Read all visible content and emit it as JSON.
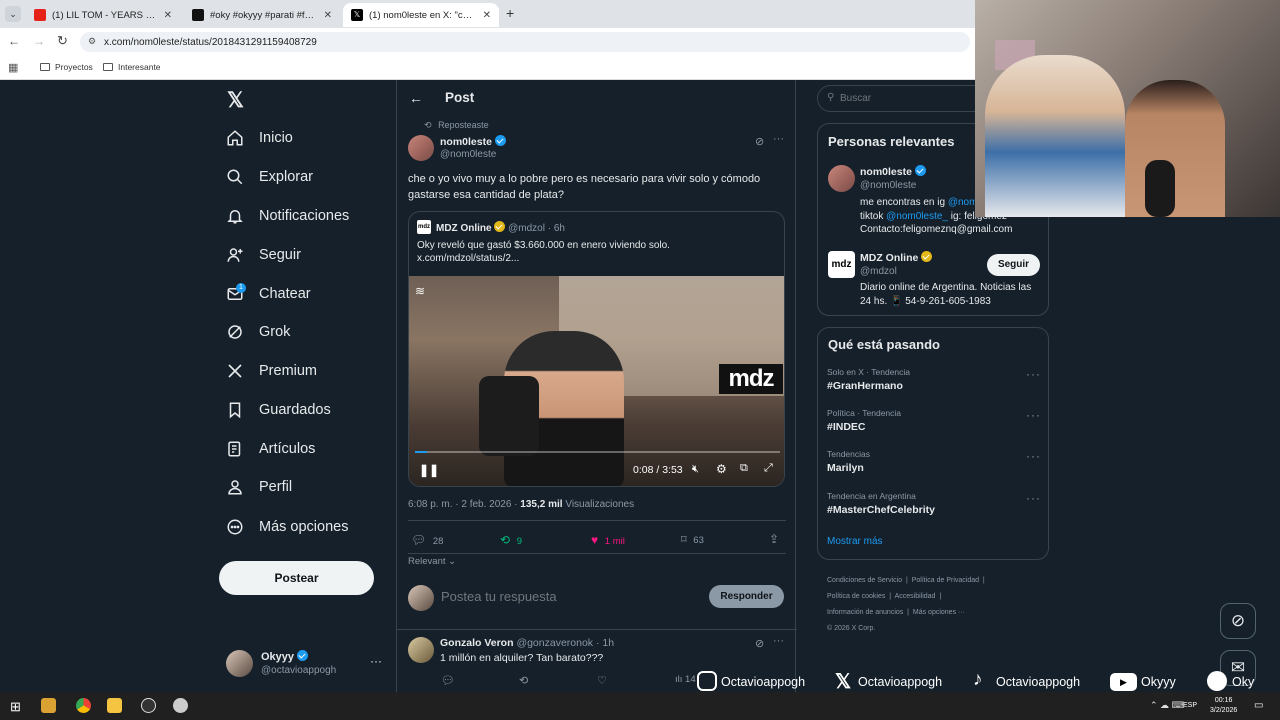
{
  "browser": {
    "tabs": [
      {
        "title": "(1) LIL TOM - YEARS + - YouTube"
      },
      {
        "title": "#oky #okyyy #parati #fyp #fory"
      },
      {
        "title": "(1) nom0leste en X: \"che o yo v"
      }
    ],
    "url": "x.com/nom0leste/status/2018431291159408729",
    "bookmarks": [
      "Proyectos",
      "Interesante"
    ]
  },
  "nav": {
    "items": [
      "Inicio",
      "Explorar",
      "Notificaciones",
      "Seguir",
      "Chatear",
      "Grok",
      "Premium",
      "Guardados",
      "Artículos",
      "Perfil",
      "Más opciones"
    ],
    "chat_badge": "1",
    "post_button": "Postear",
    "account": {
      "name": "Okyyy",
      "handle": "@octavioappogh"
    }
  },
  "post": {
    "header_title": "Post",
    "reposted_label": "Reposteaste",
    "author": {
      "name": "nom0leste",
      "handle": "@nom0leste"
    },
    "text": "che o yo vivo muy a lo pobre pero es necesario para vivir solo y cómodo gastarse esa cantidad de plata?",
    "quote": {
      "author": "MDZ Online",
      "handle": "@mdzol",
      "time": "· 6h",
      "text": "Oky reveló que gastó $3.660.000 en enero viviendo solo.",
      "link": "x.com/mdzol/status/2...",
      "video_time": "0:08 / 3:53",
      "video_progress": 0.034,
      "watermark": "mdz"
    },
    "meta": {
      "datetime": "6:08 p. m. · 2 feb. 2026 ·",
      "views": "135,2 mil",
      "views_label": "Visualizaciones"
    },
    "actions": {
      "replies": "28",
      "reposts": "9",
      "likes": "1 mil",
      "bookmarks": "63"
    },
    "sort_label": "Relevant",
    "reply_placeholder": "Postea tu respuesta",
    "reply_button": "Responder",
    "reply": {
      "author": "Gonzalo Veron",
      "handle": "@gonzaveronok",
      "time": "· 1h",
      "text": "1 millón en alquiler? Tan barato???",
      "views": "14"
    }
  },
  "right": {
    "search_placeholder": "Buscar",
    "relevant_title": "Personas relevantes",
    "people": [
      {
        "name": "nom0leste",
        "handle": "@nom0leste",
        "bio_1": "me encontras en ig",
        "bio_1_link": "@nom",
        "bio_2": "tiktok",
        "bio_2_link": "@nom0leste_",
        "bio_2_rest": " ig: feligomez",
        "bio_3": "Contacto:feligomeznq@gmail.com"
      },
      {
        "name": "MDZ Online",
        "handle": "@mdzol",
        "bio": "Diario online de Argentina. Noticias las 24 hs. 📱 54-9-261-605-1983",
        "follow": "Seguir"
      }
    ],
    "trends_title": "Qué está pasando",
    "trends": [
      {
        "context": "Solo en X · Tendencia",
        "name": "#GranHermano"
      },
      {
        "context": "Política · Tendencia",
        "name": "#INDEC"
      },
      {
        "context": "Tendencias",
        "name": "Marilyn"
      },
      {
        "context": "Tendencia en Argentina",
        "name": "#MasterChefCelebrity"
      }
    ],
    "show_more": "Mostrar más",
    "footer": [
      "Condiciones de Servicio",
      "Política de Privacidad",
      "Política de cookies",
      "Accesibilidad",
      "Información de anuncios",
      "Más opciones ···",
      "© 2026 X Corp."
    ]
  },
  "stream_overlay": {
    "socials": [
      {
        "icon": "instagram-icon",
        "text": "Octavioappogh"
      },
      {
        "icon": "x-logo-icon",
        "text": "Octavioappogh"
      },
      {
        "icon": "tiktok-icon",
        "text": "Octavioappogh"
      },
      {
        "icon": "youtube-icon",
        "text": "Okyyy"
      },
      {
        "icon": "spotify-icon",
        "text": "Oky"
      }
    ]
  },
  "taskbar": {
    "lang": "ESP",
    "time": "00:16",
    "date": "3/2/2026"
  }
}
